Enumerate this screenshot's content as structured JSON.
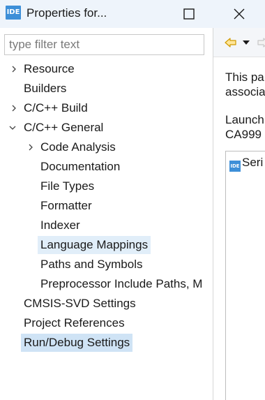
{
  "window": {
    "app_icon_text": "IDE",
    "title": "Properties for..."
  },
  "filter": {
    "placeholder": "type filter text",
    "value": ""
  },
  "tree": {
    "items": [
      {
        "label": "Resource",
        "twisty": "collapsed"
      },
      {
        "label": "Builders",
        "twisty": "none"
      },
      {
        "label": "C/C++ Build",
        "twisty": "collapsed"
      },
      {
        "label": "C/C++ General",
        "twisty": "expanded"
      },
      {
        "label": "Code Analysis",
        "twisty": "collapsed"
      },
      {
        "label": "Documentation",
        "twisty": "none"
      },
      {
        "label": "File Types",
        "twisty": "none"
      },
      {
        "label": "Formatter",
        "twisty": "none"
      },
      {
        "label": "Indexer",
        "twisty": "none"
      },
      {
        "label": "Language Mappings",
        "twisty": "none",
        "state": "hover"
      },
      {
        "label": "Paths and Symbols",
        "twisty": "none"
      },
      {
        "label": "Preprocessor Include Paths, M",
        "twisty": "none"
      },
      {
        "label": "CMSIS-SVD Settings",
        "twisty": "none"
      },
      {
        "label": "Project References",
        "twisty": "none"
      },
      {
        "label": "Run/Debug Settings",
        "twisty": "none",
        "state": "selected"
      }
    ]
  },
  "right_pane": {
    "toolbar": {
      "back_icon": "back-arrow-icon",
      "menu_icon": "dropdown-arrow-icon",
      "forward_icon": "forward-arrow-icon"
    },
    "description_line1": "This pa",
    "description_line2": "associa",
    "launch_line1": "Launch",
    "launch_line2": "CA999",
    "config_item_icon_text": "IDE",
    "config_item_label": "Seri"
  },
  "colors": {
    "titlebar_bg": "#eef4fb",
    "ide_icon": "#3d8fd8",
    "hover_bg": "#e1eef9",
    "selected_bg": "#cfe3f5",
    "back_arrow": "#e0a800"
  }
}
